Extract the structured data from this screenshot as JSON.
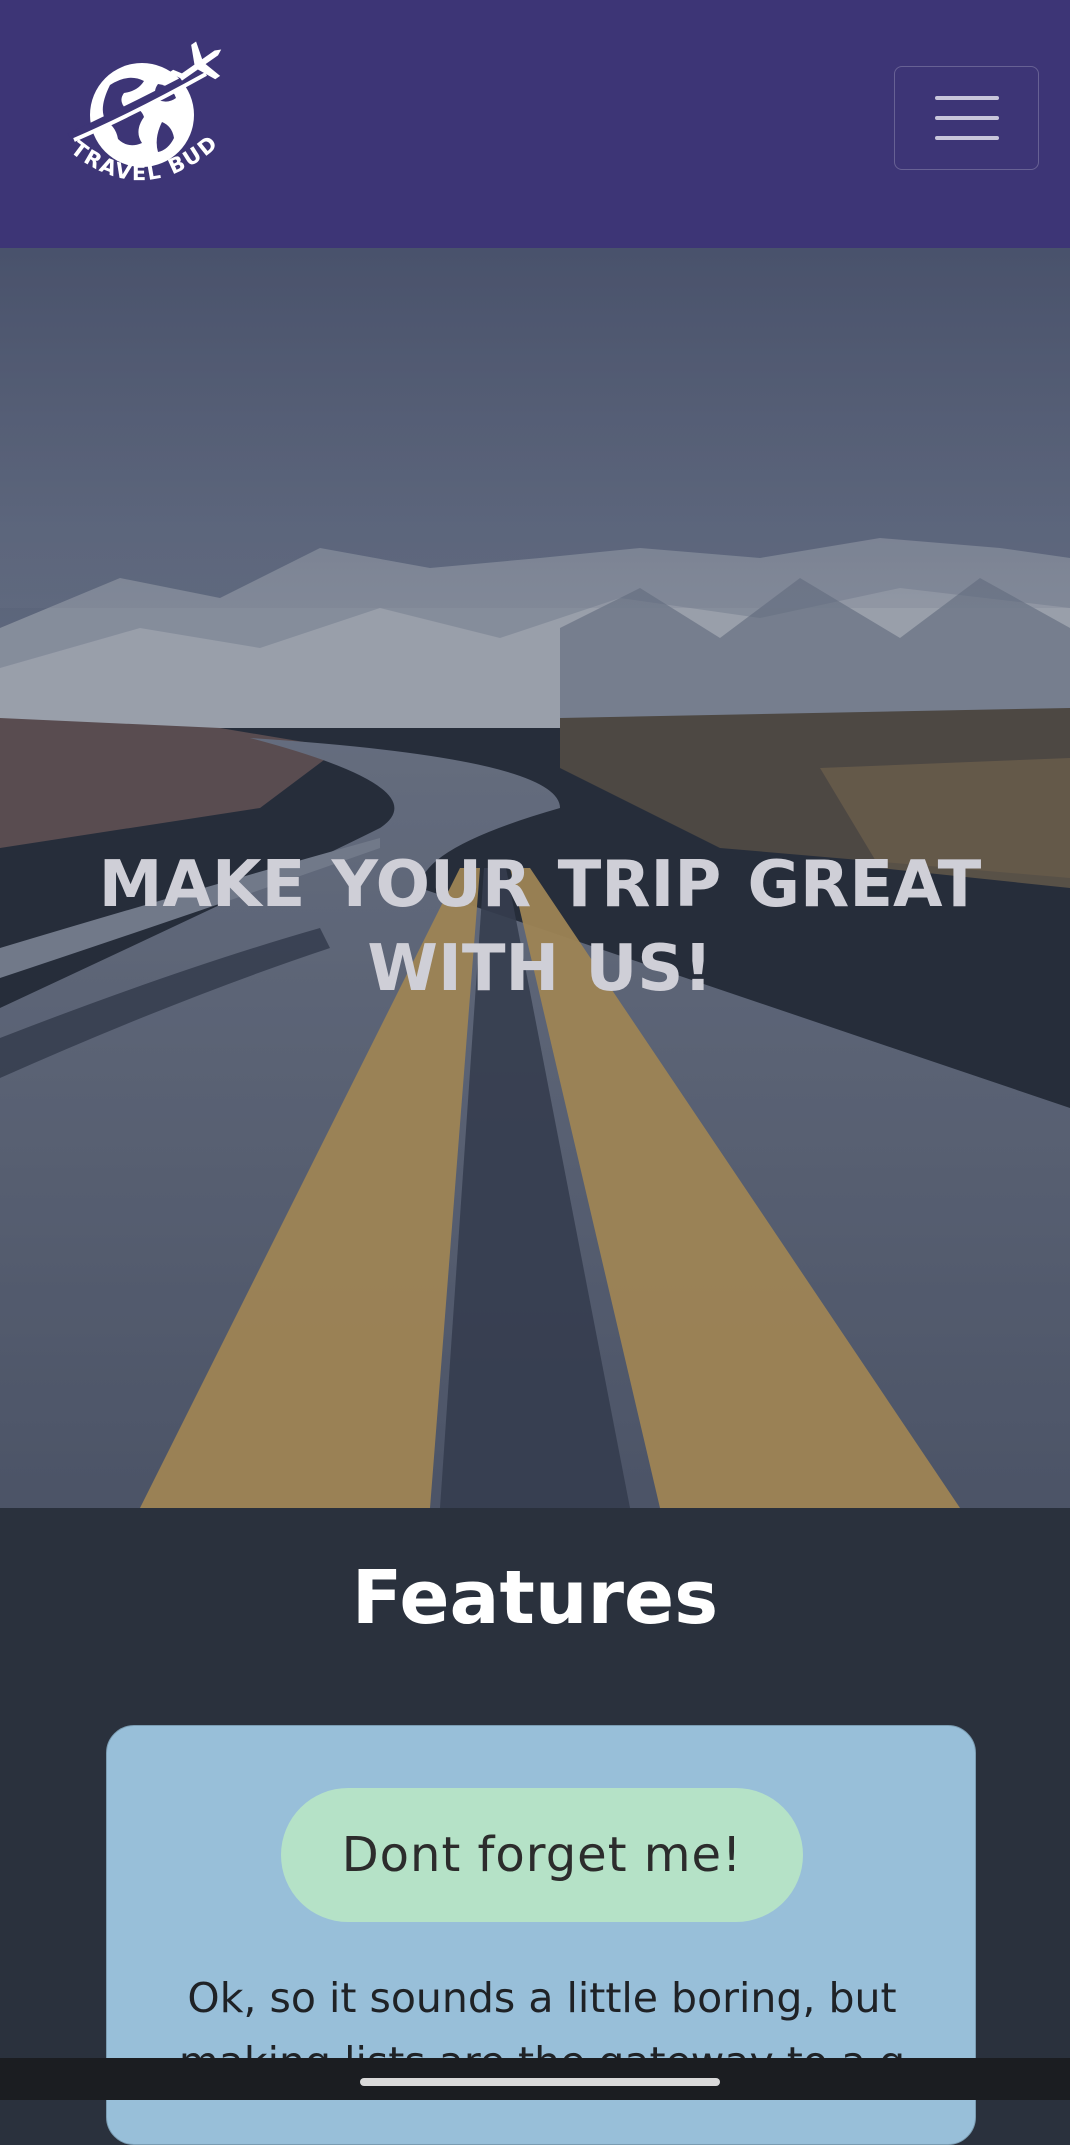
{
  "navbar": {
    "logo_text": "TRAVEL BUDDY",
    "background_color": "#3d3576",
    "menu_icon": "hamburger-icon"
  },
  "hero": {
    "headline": "MAKE YOUR TRIP  GREAT  WITH US!"
  },
  "features": {
    "title": "Features",
    "cards": [
      {
        "badge": "Dont forget me!",
        "text": "Ok, so it sounds a little boring, but making lists are the gateway to a g"
      }
    ]
  },
  "colors": {
    "features_bg": "#2a313d",
    "card_bg": "#98bfd9",
    "badge_bg": "#b5e2c7"
  }
}
